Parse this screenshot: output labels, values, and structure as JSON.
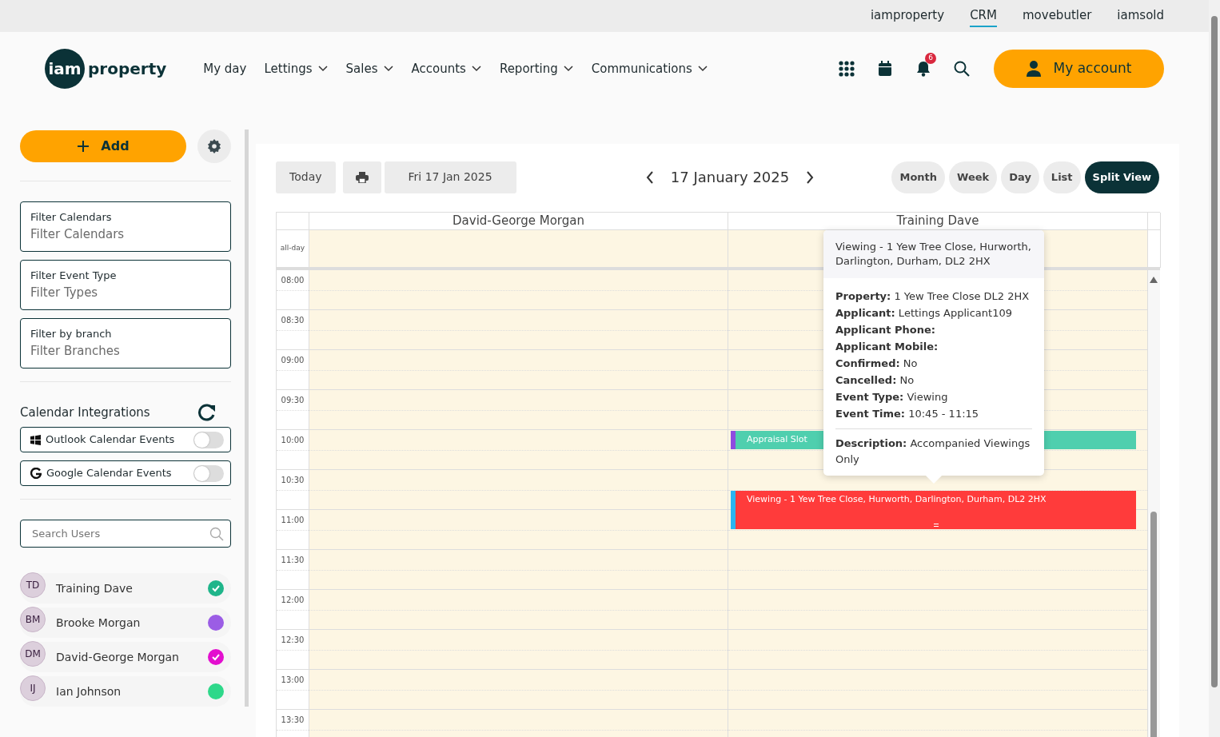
{
  "top_links": [
    {
      "label": "iamproperty",
      "selected": false
    },
    {
      "label": "CRM",
      "selected": true
    },
    {
      "label": "movebutler",
      "selected": false
    },
    {
      "label": "iamsold",
      "selected": false
    }
  ],
  "logo": {
    "part1": "iam",
    "part2": "property"
  },
  "menu": [
    {
      "label": "My day",
      "dropdown": false
    },
    {
      "label": "Lettings",
      "dropdown": true
    },
    {
      "label": "Sales",
      "dropdown": true
    },
    {
      "label": "Accounts",
      "dropdown": true
    },
    {
      "label": "Reporting",
      "dropdown": true
    },
    {
      "label": "Communications",
      "dropdown": true
    }
  ],
  "notification_count": "6",
  "account_button": "My account",
  "sidebar": {
    "add_button": "Add",
    "filters": [
      {
        "label": "Filter Calendars",
        "placeholder": "Filter Calendars"
      },
      {
        "label": "Filter Event Type",
        "placeholder": "Filter Types"
      },
      {
        "label": "Filter by branch",
        "placeholder": "Filter Branches"
      }
    ],
    "integrations": {
      "title": "Calendar Integrations",
      "items": [
        {
          "kind": "outlook",
          "label": "Outlook Calendar Events",
          "on": false
        },
        {
          "kind": "google",
          "label": "Google Calendar Events",
          "on": false
        }
      ]
    },
    "search": {
      "placeholder": "Search Users"
    },
    "users": [
      {
        "initials": "TD",
        "name": "Training Dave",
        "color": "#1fb58a",
        "checked": true
      },
      {
        "initials": "BM",
        "name": "Brooke Morgan",
        "color": "#9b5de5",
        "checked": false
      },
      {
        "initials": "DM",
        "name": "David-George Morgan",
        "color": "#e30fcf",
        "checked": true
      },
      {
        "initials": "IJ",
        "name": "Ian Johnson",
        "color": "#2ed88a",
        "checked": false
      }
    ]
  },
  "calendar": {
    "today_button": "Today",
    "date_field": "Fri 17 Jan 2025",
    "title": "17 January 2025",
    "views": [
      {
        "label": "Month",
        "selected": false
      },
      {
        "label": "Week",
        "selected": false
      },
      {
        "label": "Day",
        "selected": false
      },
      {
        "label": "List",
        "selected": false
      },
      {
        "label": "Split View",
        "selected": true
      }
    ],
    "columns": [
      "David-George Morgan",
      "Training Dave"
    ],
    "allday_label": "all-day",
    "times": [
      "08:00",
      "08:30",
      "09:00",
      "09:30",
      "10:00",
      "10:30",
      "11:00",
      "11:30",
      "12:00",
      "12:30",
      "13:00",
      "13:30"
    ],
    "events": [
      {
        "kind": "appraisal",
        "title": "Appraisal Slot",
        "color": "#4fcfae"
      },
      {
        "kind": "viewing",
        "title": "Viewing - 1 Yew Tree Close, Hurworth, Darlington, Durham, DL2 2HX",
        "color": "#ff3b3b"
      }
    ],
    "popover": {
      "title": "Viewing - 1 Yew Tree Close, Hurworth, Darlington, Durham, DL2 2HX",
      "fields": [
        {
          "label": "Property:",
          "value": "1 Yew Tree Close DL2 2HX"
        },
        {
          "label": "Applicant:",
          "value": "Lettings Applicant109"
        },
        {
          "label": "Applicant Phone:"
        },
        {
          "label": "Applicant Mobile:"
        },
        {
          "label": "Confirmed:",
          "value": "No"
        },
        {
          "label": "Cancelled:",
          "value": "No"
        },
        {
          "label": "Event Type:",
          "value": "Viewing"
        },
        {
          "label": "Event Time:",
          "value": "10:45 - 11:15"
        }
      ],
      "description": {
        "label": "Description:",
        "value": "Accompanied Viewings Only"
      }
    }
  }
}
